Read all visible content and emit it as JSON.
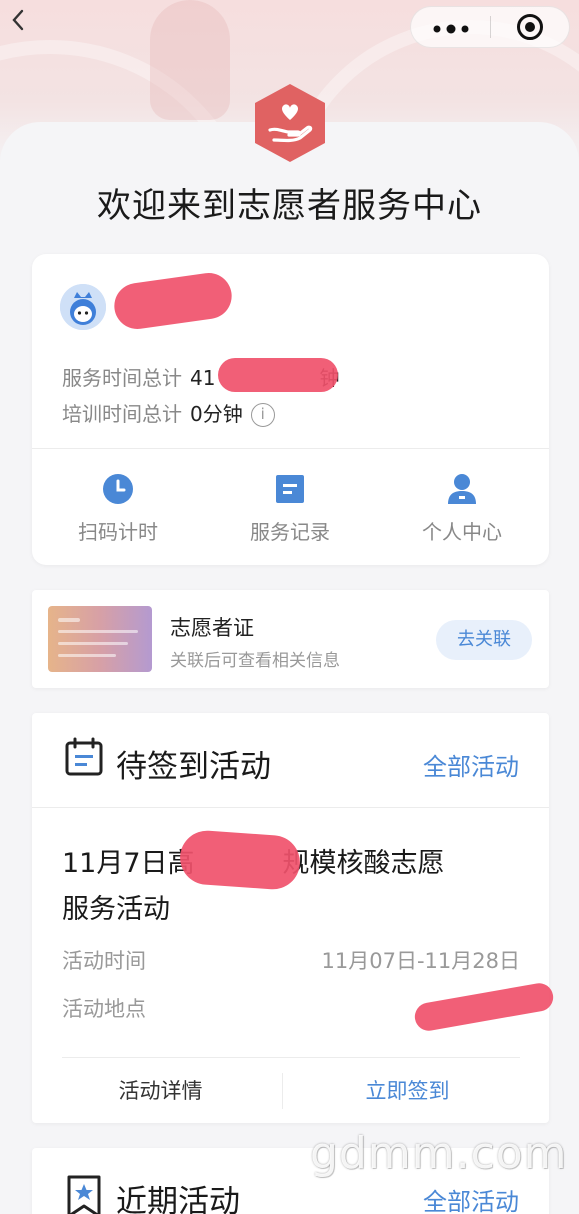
{
  "nav": {
    "back_icon": "chevron-left-icon",
    "more_icon": "more-dots-icon",
    "close_icon": "target-circle-icon"
  },
  "header": {
    "welcome": "欢迎来到志愿者服务中心"
  },
  "user": {
    "service_time_label": "服务时间总计",
    "service_time_value_visible": "41",
    "service_time_suffix": "钟",
    "training_time_label": "培训时间总计",
    "training_time_value": "0分钟"
  },
  "quick_actions": [
    {
      "label": "扫码计时",
      "icon": "clock-icon"
    },
    {
      "label": "服务记录",
      "icon": "document-icon"
    },
    {
      "label": "个人中心",
      "icon": "user-icon"
    }
  ],
  "certificate": {
    "title": "志愿者证",
    "subtitle": "关联后可查看相关信息",
    "button": "去关联"
  },
  "pending": {
    "title": "待签到活动",
    "all_link": "全部活动",
    "activity": {
      "name_part1": "11月7日",
      "name_part1b": "高",
      "name_part2": "模核酸志愿",
      "name_part2a": "规",
      "name_line2": "服务活动",
      "time_label": "活动时间",
      "time_value": "11月07日-11月28日",
      "place_label": "活动地点"
    },
    "detail_button": "活动详情",
    "signin_button": "立即签到"
  },
  "recent": {
    "title": "近期活动",
    "all_link": "全部活动"
  },
  "watermark": "gdmm.com",
  "colors": {
    "accent": "#4a88d6",
    "logo": "#e06262",
    "redact": "#f0516b"
  }
}
